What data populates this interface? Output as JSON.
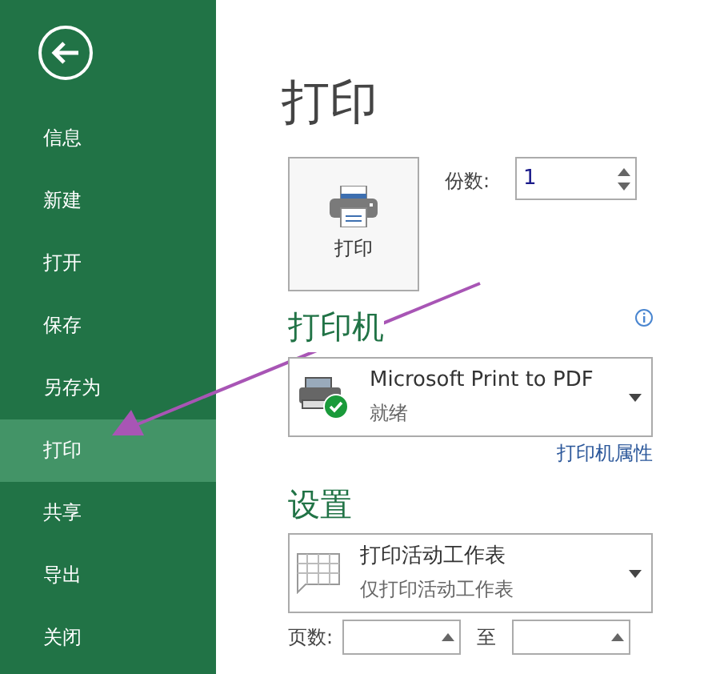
{
  "sidebar": {
    "items": [
      {
        "label": "信息",
        "selected": false
      },
      {
        "label": "新建",
        "selected": false
      },
      {
        "label": "打开",
        "selected": false
      },
      {
        "label": "保存",
        "selected": false
      },
      {
        "label": "另存为",
        "selected": false
      },
      {
        "label": "打印",
        "selected": true
      },
      {
        "label": "共享",
        "selected": false
      },
      {
        "label": "导出",
        "selected": false
      },
      {
        "label": "关闭",
        "selected": false
      }
    ]
  },
  "title": "打印",
  "print_button": {
    "label": "打印"
  },
  "copies": {
    "label": "份数:",
    "value": "1"
  },
  "printer": {
    "heading": "打印机",
    "name": "Microsoft Print to PDF",
    "status": "就绪",
    "properties_link": "打印机属性"
  },
  "settings": {
    "heading": "设置",
    "scope": {
      "title": "打印活动工作表",
      "subtitle": "仅打印活动工作表"
    },
    "pages": {
      "label": "页数:",
      "to_label": "至"
    }
  }
}
